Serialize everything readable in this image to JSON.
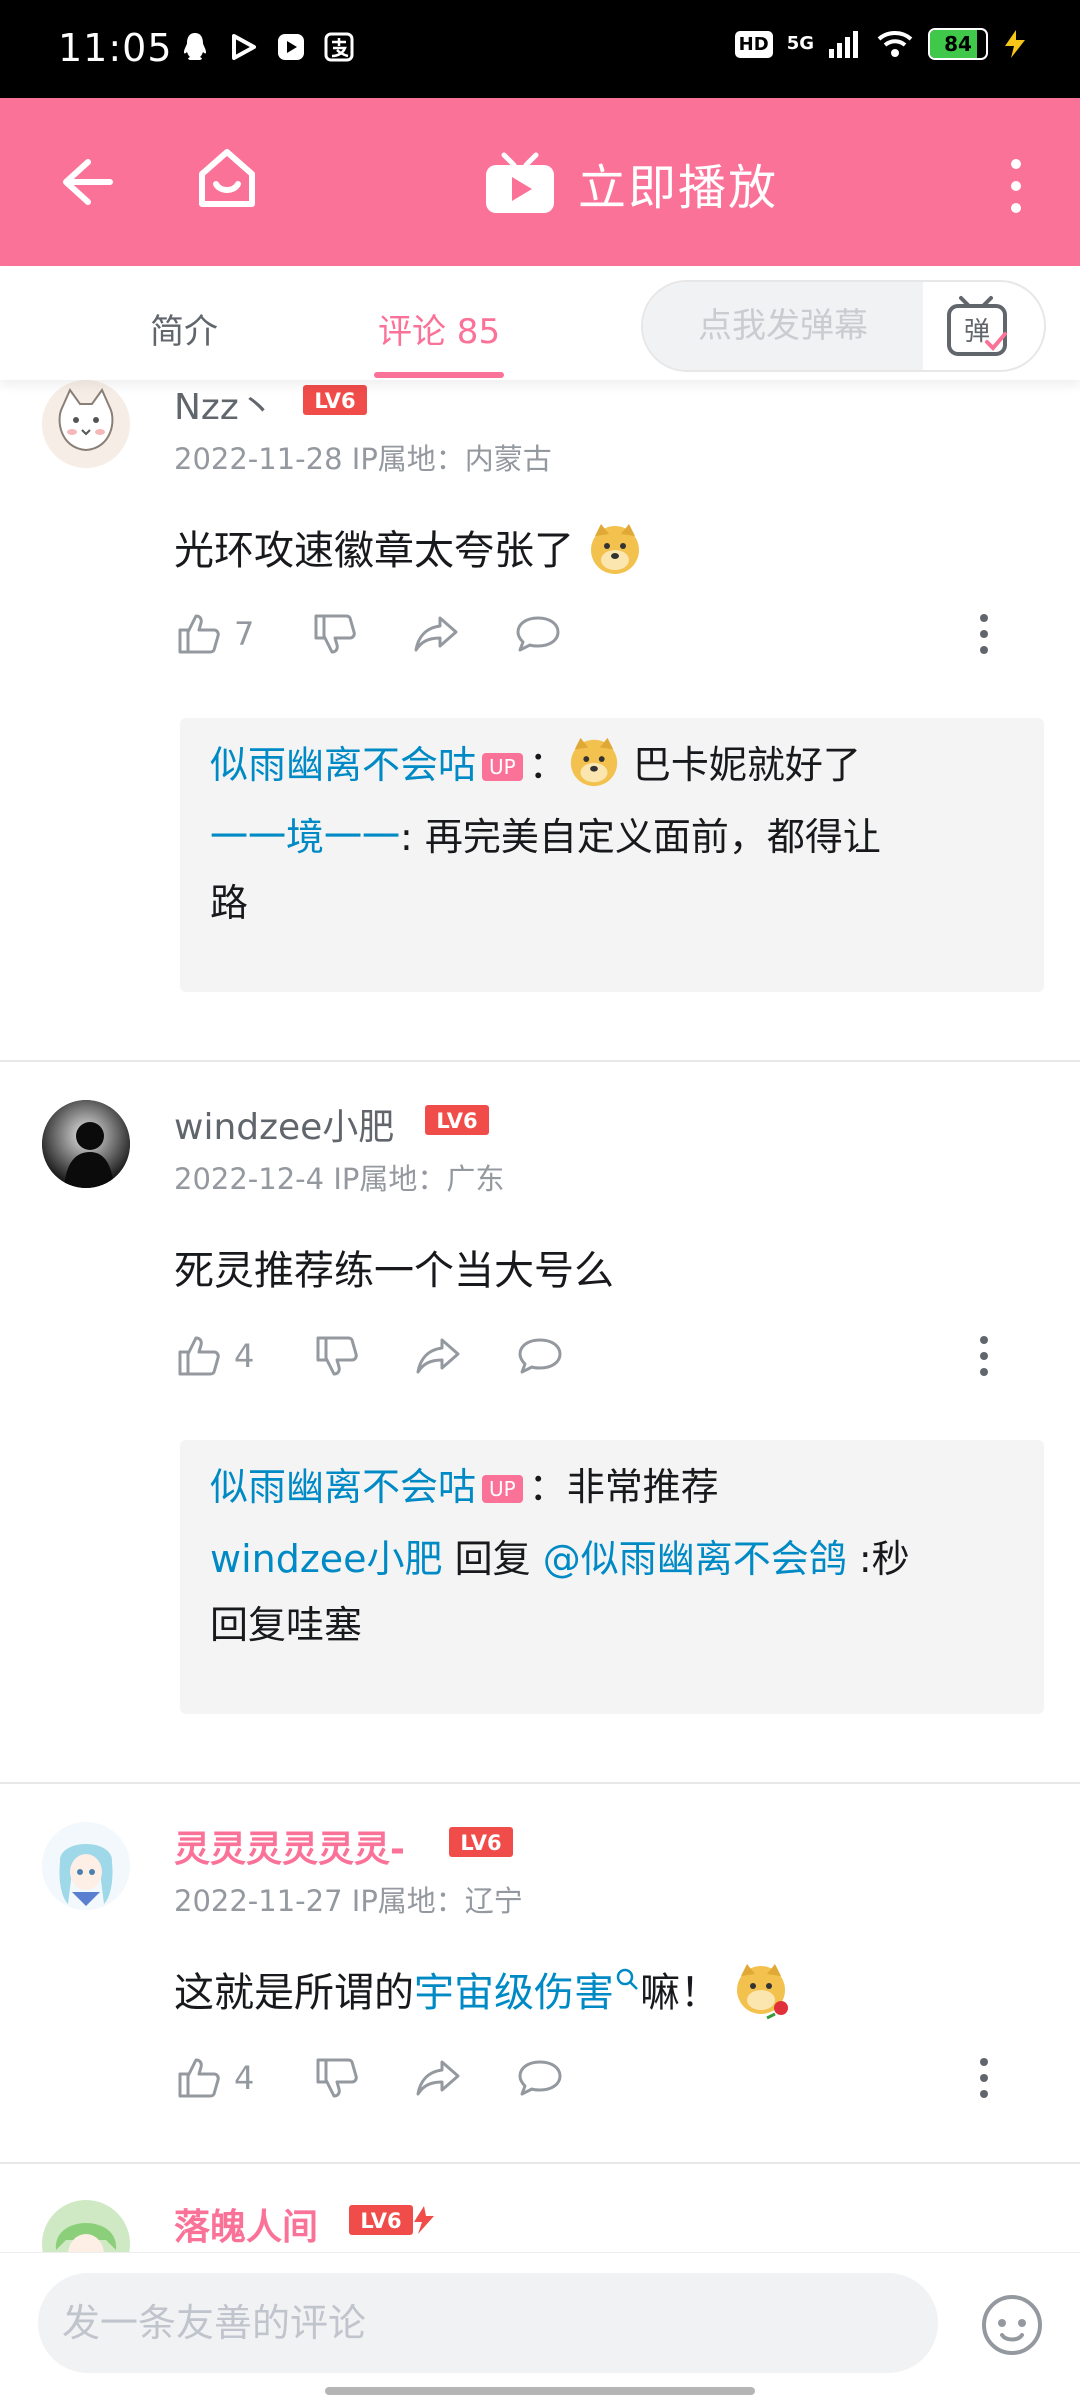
{
  "status_bar": {
    "time": "11:05",
    "hd": "HD",
    "network": "5G",
    "battery": "84",
    "battery_level": 0.84
  },
  "header": {
    "title": "立即播放"
  },
  "tabs": {
    "intro": "简介",
    "comments": "评论 85"
  },
  "danmaku": {
    "placeholder": "点我发弹幕",
    "button_label": "弹"
  },
  "comments": [
    {
      "username": "Nzz丶",
      "level": "LV6",
      "date": "2022-11-28",
      "location": "IP属地：内蒙古",
      "text": "光环攻速徽章太夸张了",
      "likes": "7",
      "replies": [
        {
          "user": "似雨幽离不会咕",
          "badge": "UP",
          "sep": "：",
          "text": "巴卡妮就好了"
        },
        {
          "user": "一一境一一",
          "sep": ": ",
          "text": "再完美自定义面前，都得让",
          "text2": "路"
        }
      ]
    },
    {
      "username": "windzee小肥",
      "level": "LV6",
      "date": "2022-12-4",
      "location": "IP属地：广东",
      "text": "死灵推荐练一个当大号么",
      "likes": "4",
      "replies": [
        {
          "user": "似雨幽离不会咕",
          "badge": "UP",
          "sep": "：",
          "text": "非常推荐"
        },
        {
          "user": "windzee小肥",
          "mid": " 回复 ",
          "mention": "@似雨幽离不会鸽",
          "text": " :秒",
          "text2": "回复哇塞"
        }
      ]
    },
    {
      "username": "灵灵灵灵灵灵-",
      "level": "LV6",
      "date": "2022-11-27",
      "location": "IP属地：辽宁",
      "text_before": "这就是所谓的",
      "text_link": "宇宙级伤害",
      "text_after": "嘛！",
      "likes": "4"
    },
    {
      "username": "落魄人间",
      "level": "LV6"
    }
  ],
  "bottom": {
    "placeholder": "发一条友善的评论"
  },
  "colors": {
    "brand_pink": "#fb7299",
    "link_blue": "#008ac5",
    "level_red": "#f04c49"
  }
}
